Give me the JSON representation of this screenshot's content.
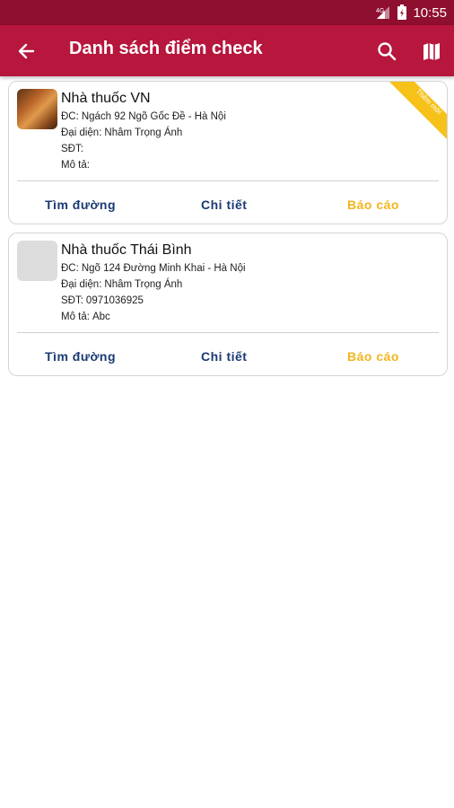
{
  "status_bar": {
    "time": "10:55",
    "icons": [
      "signal-icon",
      "battery-icon"
    ]
  },
  "app_bar": {
    "title": "Danh sách điểm check",
    "back_icon": "arrow-left-icon",
    "search_icon": "search-icon",
    "map_icon": "map-icon"
  },
  "colors": {
    "status_bar": "#8e0f2f",
    "app_bar": "#b7163d",
    "action_primary": "#1b3a73",
    "action_report": "#f2b51b",
    "ribbon": "#f6c21a"
  },
  "points": [
    {
      "name": "Nhà thuốc VN",
      "address_label": "ĐC:",
      "address": "Ngách 92 Ngõ Gốc Đề - Hà Nội",
      "rep_label": "Đại diện:",
      "rep": "Nhâm Trọng Ánh",
      "phone_label": "SĐT:",
      "phone": "",
      "desc_label": "Mô tả:",
      "desc": "",
      "ribbon": "Thêm mới",
      "actions": {
        "route": "Tìm đường",
        "detail": "Chi tiết",
        "report": "Báo cáo"
      }
    },
    {
      "name": "Nhà thuốc Thái Bình",
      "address_label": "ĐC:",
      "address": "Ngõ 124 Đường Minh Khai - Hà Nội",
      "rep_label": "Đại diện:",
      "rep": "Nhâm Trọng Ánh",
      "phone_label": "SĐT:",
      "phone": "0971036925",
      "desc_label": "Mô tả:",
      "desc": "Abc",
      "actions": {
        "route": "Tìm đường",
        "detail": "Chi tiết",
        "report": "Báo cáo"
      }
    }
  ]
}
